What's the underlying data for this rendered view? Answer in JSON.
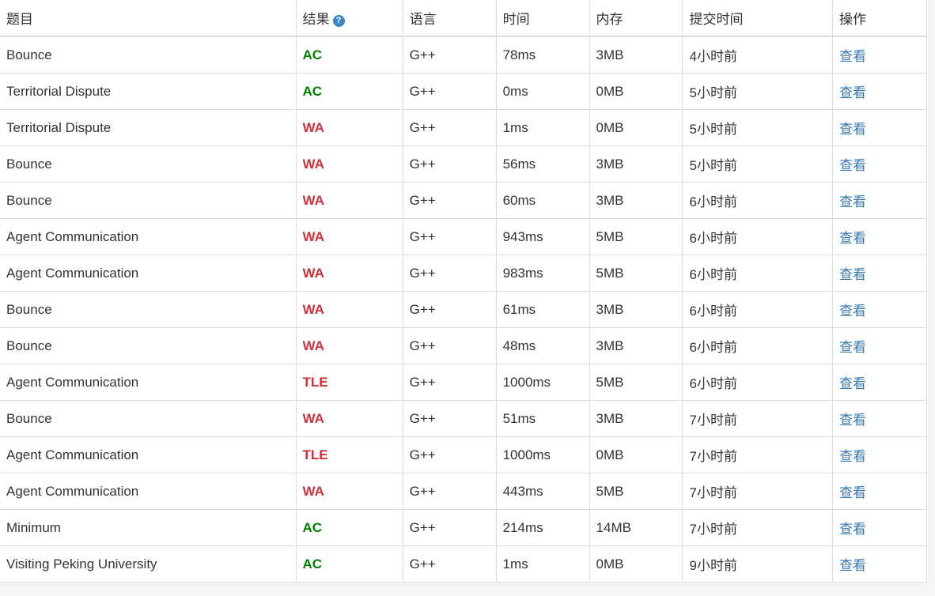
{
  "headers": {
    "problem": "题目",
    "result": "结果",
    "language": "语言",
    "time": "时间",
    "memory": "内存",
    "submit_time": "提交时间",
    "action": "操作"
  },
  "help_icon_glyph": "?",
  "colors": {
    "ac": "#008000",
    "wa": "#d0303a",
    "tle": "#d0303a",
    "link": "#337ab7"
  },
  "rows": [
    {
      "problem": "Bounce",
      "result": "AC",
      "language": "G++",
      "time": "78ms",
      "memory": "3MB",
      "submitted": "4小时前",
      "action": "查看"
    },
    {
      "problem": "Territorial Dispute",
      "result": "AC",
      "language": "G++",
      "time": "0ms",
      "memory": "0MB",
      "submitted": "5小时前",
      "action": "查看"
    },
    {
      "problem": "Territorial Dispute",
      "result": "WA",
      "language": "G++",
      "time": "1ms",
      "memory": "0MB",
      "submitted": "5小时前",
      "action": "查看"
    },
    {
      "problem": "Bounce",
      "result": "WA",
      "language": "G++",
      "time": "56ms",
      "memory": "3MB",
      "submitted": "5小时前",
      "action": "查看"
    },
    {
      "problem": "Bounce",
      "result": "WA",
      "language": "G++",
      "time": "60ms",
      "memory": "3MB",
      "submitted": "6小时前",
      "action": "查看"
    },
    {
      "problem": "Agent Communication",
      "result": "WA",
      "language": "G++",
      "time": "943ms",
      "memory": "5MB",
      "submitted": "6小时前",
      "action": "查看"
    },
    {
      "problem": "Agent Communication",
      "result": "WA",
      "language": "G++",
      "time": "983ms",
      "memory": "5MB",
      "submitted": "6小时前",
      "action": "查看"
    },
    {
      "problem": "Bounce",
      "result": "WA",
      "language": "G++",
      "time": "61ms",
      "memory": "3MB",
      "submitted": "6小时前",
      "action": "查看"
    },
    {
      "problem": "Bounce",
      "result": "WA",
      "language": "G++",
      "time": "48ms",
      "memory": "3MB",
      "submitted": "6小时前",
      "action": "查看"
    },
    {
      "problem": "Agent Communication",
      "result": "TLE",
      "language": "G++",
      "time": "1000ms",
      "memory": "5MB",
      "submitted": "6小时前",
      "action": "查看"
    },
    {
      "problem": "Bounce",
      "result": "WA",
      "language": "G++",
      "time": "51ms",
      "memory": "3MB",
      "submitted": "7小时前",
      "action": "查看"
    },
    {
      "problem": "Agent Communication",
      "result": "TLE",
      "language": "G++",
      "time": "1000ms",
      "memory": "0MB",
      "submitted": "7小时前",
      "action": "查看"
    },
    {
      "problem": "Agent Communication",
      "result": "WA",
      "language": "G++",
      "time": "443ms",
      "memory": "5MB",
      "submitted": "7小时前",
      "action": "查看"
    },
    {
      "problem": "Minimum",
      "result": "AC",
      "language": "G++",
      "time": "214ms",
      "memory": "14MB",
      "submitted": "7小时前",
      "action": "查看"
    },
    {
      "problem": "Visiting Peking University",
      "result": "AC",
      "language": "G++",
      "time": "1ms",
      "memory": "0MB",
      "submitted": "9小时前",
      "action": "查看"
    }
  ]
}
